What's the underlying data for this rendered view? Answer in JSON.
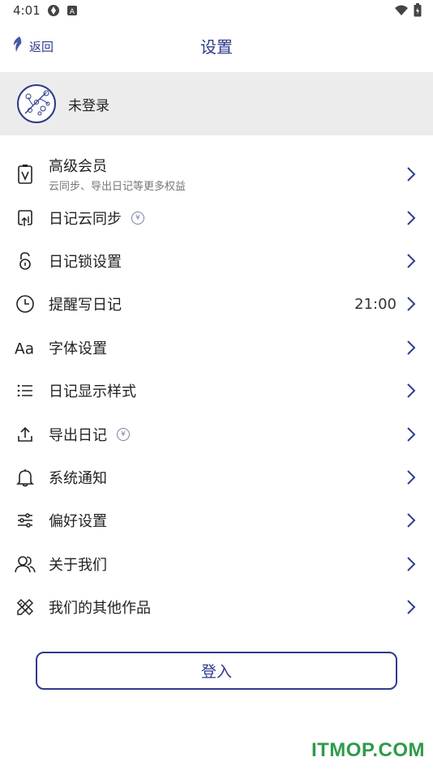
{
  "status_bar": {
    "time": "4:01",
    "left_icons": [
      "aperture-icon",
      "a-box-icon"
    ],
    "right_icons": [
      "wifi-icon",
      "battery-icon"
    ]
  },
  "nav": {
    "back_label": "返回",
    "title": "设置"
  },
  "profile": {
    "name": "未登录"
  },
  "menu": [
    {
      "icon": "vip-card-icon",
      "label": "高级会员",
      "subtitle": "云同步、导出日记等更多权益",
      "value": "",
      "badge": false
    },
    {
      "icon": "cloud-sync-icon",
      "label": "日记云同步",
      "subtitle": "",
      "value": "",
      "badge": true
    },
    {
      "icon": "lock-icon",
      "label": "日记锁设置",
      "subtitle": "",
      "value": "",
      "badge": false
    },
    {
      "icon": "clock-icon",
      "label": "提醒写日记",
      "subtitle": "",
      "value": "21:00",
      "badge": false
    },
    {
      "icon": "font-icon",
      "label": "字体设置",
      "subtitle": "",
      "value": "",
      "badge": false
    },
    {
      "icon": "list-icon",
      "label": "日记显示样式",
      "subtitle": "",
      "value": "",
      "badge": false
    },
    {
      "icon": "upload-icon",
      "label": "导出日记",
      "subtitle": "",
      "value": "",
      "badge": true
    },
    {
      "icon": "bell-icon",
      "label": "系统通知",
      "subtitle": "",
      "value": "",
      "badge": false
    },
    {
      "icon": "sliders-icon",
      "label": "偏好设置",
      "subtitle": "",
      "value": "",
      "badge": false
    },
    {
      "icon": "people-icon",
      "label": "关于我们",
      "subtitle": "",
      "value": "",
      "badge": false
    },
    {
      "icon": "tools-icon",
      "label": "我们的其他作品",
      "subtitle": "",
      "value": "",
      "badge": false
    }
  ],
  "login_button": "登入",
  "badge_glyph": "¥",
  "watermark": "ITMOP.COM",
  "colors": {
    "accent": "#2e3a8c",
    "profile_bg": "#ececec",
    "watermark": "#2e9a4a"
  }
}
